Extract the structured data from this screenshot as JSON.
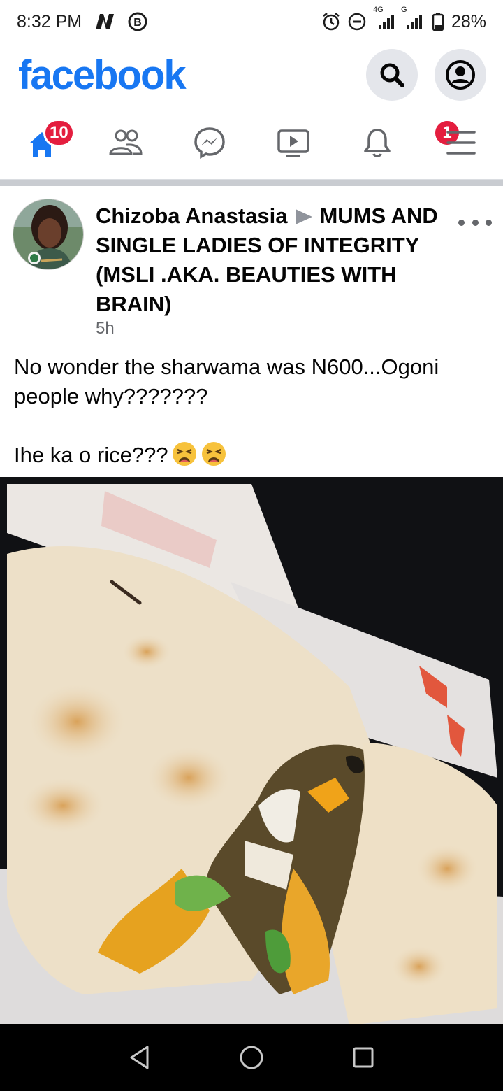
{
  "status_bar": {
    "time": "8:32 PM",
    "network_label": "4G",
    "signal_label": "G",
    "battery": "28%"
  },
  "header": {
    "brand": "facebook"
  },
  "nav": {
    "home_badge": "10",
    "notifications_badge": "1"
  },
  "post": {
    "author": "Chizoba Anastasia",
    "group": "MUMS AND SINGLE LADIES OF INTEGRITY (MSLI .AKA. BEAUTIES WITH BRAIN)",
    "time": "5h",
    "text_line1": "No wonder the sharwama was N600...Ogoni people why???????",
    "text_line2": "Ihe ka o rice???"
  },
  "colors": {
    "brand": "#1877f2",
    "badge": "#e41e3f",
    "icon_gray": "#65676b"
  }
}
